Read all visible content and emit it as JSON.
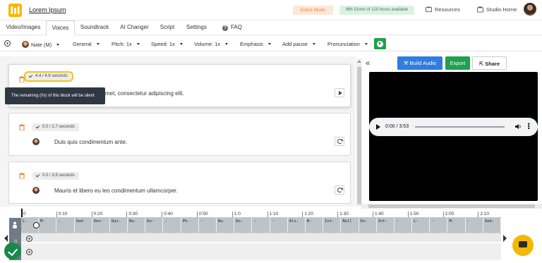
{
  "header": {
    "brand": "Lorem Ipsum",
    "editor_mode": "Editor Mode",
    "minutes_available": "98h 51min of 120 hours available",
    "resources": "Resources",
    "studio_home": "Studio Home"
  },
  "tabs": [
    "Video/Images",
    "Voices",
    "Soundtrack",
    "AI Changer",
    "Script",
    "Settings",
    "FAQ"
  ],
  "active_tab": "Voices",
  "toolbar": {
    "voice": "Nate (M)",
    "style": "General",
    "pitch": "Pitch: 1x",
    "speed": "Speed: 1x",
    "volume": "Volume: 1x",
    "emphasis": "Emphasis",
    "add_pause": "Add pause",
    "pronunciation": "Pronunciation"
  },
  "blocks": [
    {
      "duration": "4.4 / 4.6 seconds",
      "text": "Lorem ipsum dolor sit amet, consectetur adipiscing elit.",
      "visible_text": "met, consectetur adipiscing elit."
    },
    {
      "duration": "0.0 / 2.7 seconds",
      "text": "Duis quis condimentum ante."
    },
    {
      "duration": "0.0 / 3.9 seconds",
      "text": "Mauris et libero eu leo condimentum ullamcorper."
    }
  ],
  "tooltip": "The remaining (0s) of this block will be silent",
  "actions": {
    "build": "Build Audio",
    "export": "Export",
    "share": "Share"
  },
  "player": {
    "time": "0:00 / 3:53",
    "progress": 0
  },
  "timeline": {
    "ticks": [
      "0",
      "0:10",
      "0:20",
      "0:30",
      "0:40",
      "0:50",
      "1:0",
      "1:10",
      "1:20",
      "1:30",
      "1:40",
      "1:50",
      "2:00",
      "2:10"
    ],
    "clips": [
      "L-",
      "M-",
      "-",
      "Sed-",
      "Ves-",
      "Qui-",
      "Nu-",
      "Do-",
      "-",
      "Ph-",
      "-",
      "Nu-",
      "Do-",
      "-",
      "-",
      "Ali-",
      "N-",
      "Int-",
      "Null",
      "Do-",
      "Int-",
      "-",
      "L-",
      "-",
      "M-",
      "-",
      "Sed-"
    ]
  },
  "colors": {
    "accent_blue": "#2f7de1",
    "accent_green": "#21a050",
    "highlight": "#f2c518",
    "chat": "#f5b800"
  }
}
